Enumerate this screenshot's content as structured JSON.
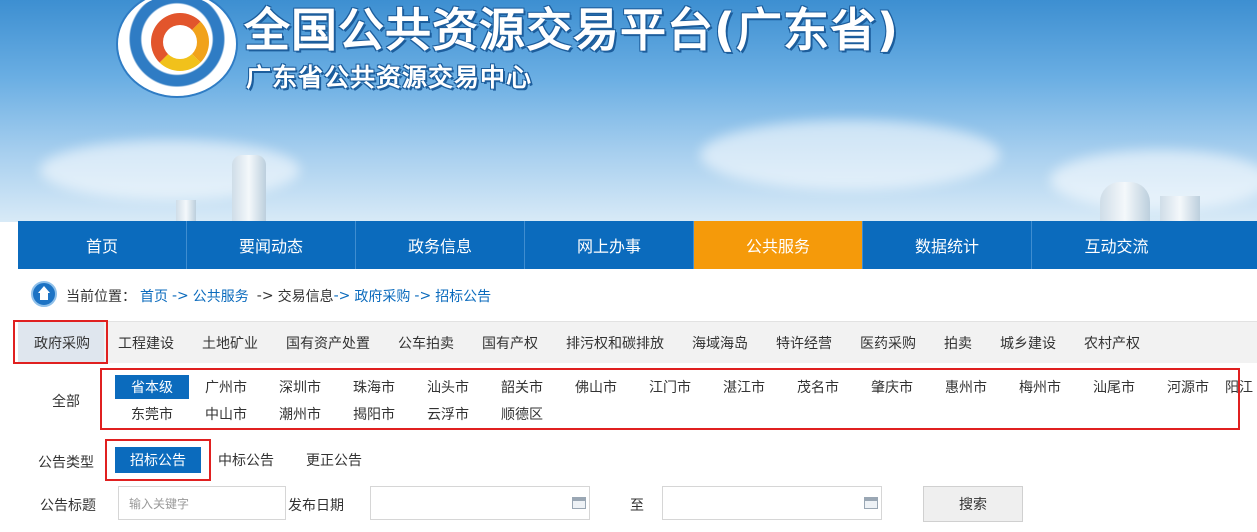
{
  "header": {
    "title": "全国公共资源交易平台(广东省)",
    "subtitle": "广东省公共资源交易中心",
    "logo_icon": "guangdong-public-resources-logo-icon"
  },
  "nav": {
    "items": [
      {
        "label": "首页"
      },
      {
        "label": "要闻动态"
      },
      {
        "label": "政务信息"
      },
      {
        "label": "网上办事"
      },
      {
        "label": "公共服务",
        "active": true
      },
      {
        "label": "数据统计"
      },
      {
        "label": "互动交流"
      }
    ],
    "active_color": "#f59a0a",
    "bar_color": "#0b6bbd"
  },
  "breadcrumb": {
    "label": "当前位置：",
    "home": "首页",
    "sep": "->",
    "public_service": "公共服务",
    "trade_info": "交易信息",
    "gov_procurement": "政府采购",
    "current": "招标公告"
  },
  "categories": {
    "items": [
      "政府采购",
      "工程建设",
      "土地矿业",
      "国有资产处置",
      "公车拍卖",
      "国有产权",
      "排污权和碳排放",
      "海域海岛",
      "特许经营",
      "医药采购",
      "拍卖",
      "城乡建设",
      "农村产权"
    ],
    "active_index": 0
  },
  "regions": {
    "label": "全部",
    "row1": [
      "省本级",
      "广州市",
      "深圳市",
      "珠海市",
      "汕头市",
      "韶关市",
      "佛山市",
      "江门市",
      "湛江市",
      "茂名市",
      "肇庆市",
      "惠州市",
      "梅州市",
      "汕尾市",
      "河源市",
      "阳江"
    ],
    "row2": [
      "东莞市",
      "中山市",
      "潮州市",
      "揭阳市",
      "云浮市",
      "顺德区"
    ],
    "active": "省本级"
  },
  "notice_type": {
    "label": "公告类型",
    "options": [
      "招标公告",
      "中标公告",
      "更正公告"
    ],
    "active": "招标公告"
  },
  "search": {
    "title_label": "公告标题",
    "title_placeholder": "输入关键字",
    "date_label": "发布日期",
    "to_label": "至",
    "button": "搜索"
  },
  "highlight_color": "#e02020"
}
